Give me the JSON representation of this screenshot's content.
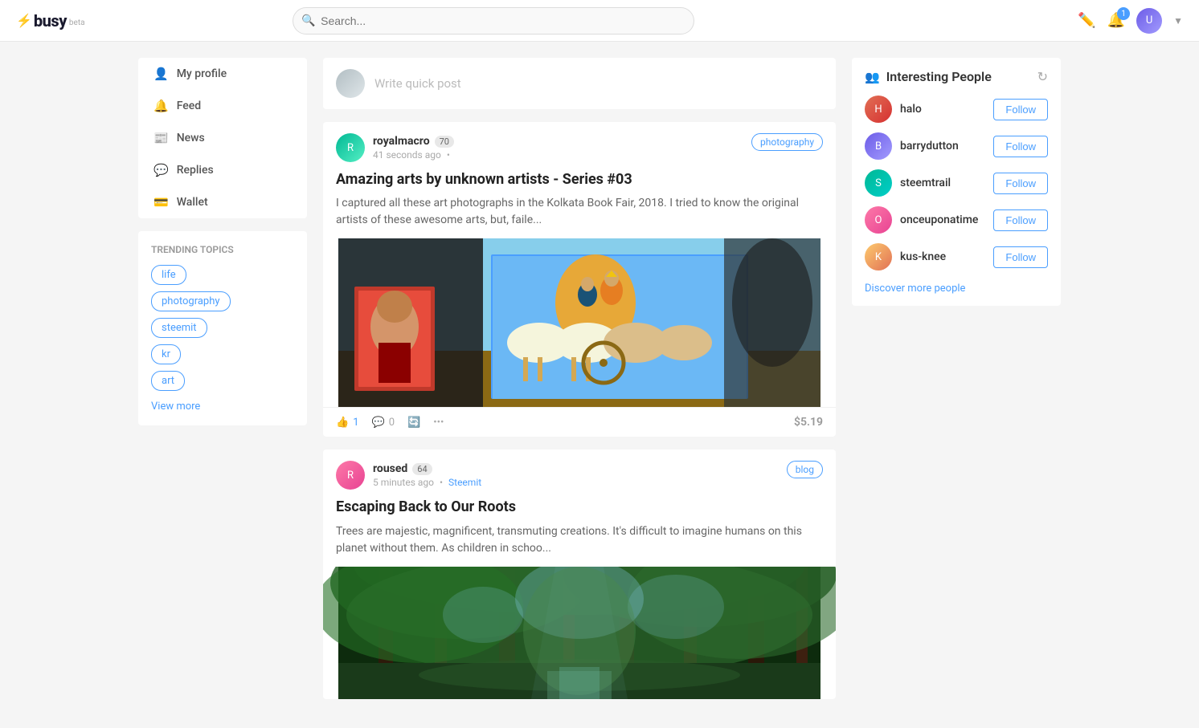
{
  "header": {
    "logo_text": "busy",
    "logo_beta": "beta",
    "search_placeholder": "Search...",
    "notification_count": "1"
  },
  "sidebar": {
    "nav_items": [
      {
        "id": "my-profile",
        "label": "My profile",
        "icon": "👤"
      },
      {
        "id": "feed",
        "label": "Feed",
        "icon": "🔔"
      },
      {
        "id": "news",
        "label": "News",
        "icon": "📰"
      },
      {
        "id": "replies",
        "label": "Replies",
        "icon": "💬"
      },
      {
        "id": "wallet",
        "label": "Wallet",
        "icon": "💳"
      }
    ],
    "trending_title": "Trending topics",
    "tags": [
      "life",
      "photography",
      "steemit",
      "kr",
      "art"
    ],
    "view_more_label": "View more"
  },
  "quick_post": {
    "placeholder": "Write quick post"
  },
  "posts": [
    {
      "id": "post-1",
      "author": "royalmacro",
      "rep": "70",
      "time": "41 seconds ago",
      "source": "",
      "tag": "photography",
      "title": "Amazing arts by unknown artists - Series #03",
      "excerpt": "I captured all these art photographs in the Kolkata Book Fair, 2018. I tried to know the original artists of these awesome arts, but, faile...",
      "likes": "1",
      "comments": "0",
      "value": "$5.19"
    },
    {
      "id": "post-2",
      "author": "roused",
      "rep": "64",
      "time": "5 minutes ago",
      "source": "Steemit",
      "tag": "blog",
      "title": "Escaping Back to Our Roots",
      "excerpt": "Trees are majestic, magnificent, transmuting creations. It's difficult to imagine humans on this planet without them. As children in schoo...",
      "likes": "",
      "comments": "",
      "value": ""
    }
  ],
  "interesting_people": {
    "title": "Interesting People",
    "people": [
      {
        "name": "halo",
        "avatar_class": "pa-halo"
      },
      {
        "name": "barrydutton",
        "avatar_class": "pa-barry"
      },
      {
        "name": "steemtrail",
        "avatar_class": "pa-steem"
      },
      {
        "name": "onceuponatime",
        "avatar_class": "pa-once"
      },
      {
        "name": "kus-knee",
        "avatar_class": "pa-kus"
      }
    ],
    "follow_label": "Follow",
    "discover_label": "Discover more people"
  }
}
